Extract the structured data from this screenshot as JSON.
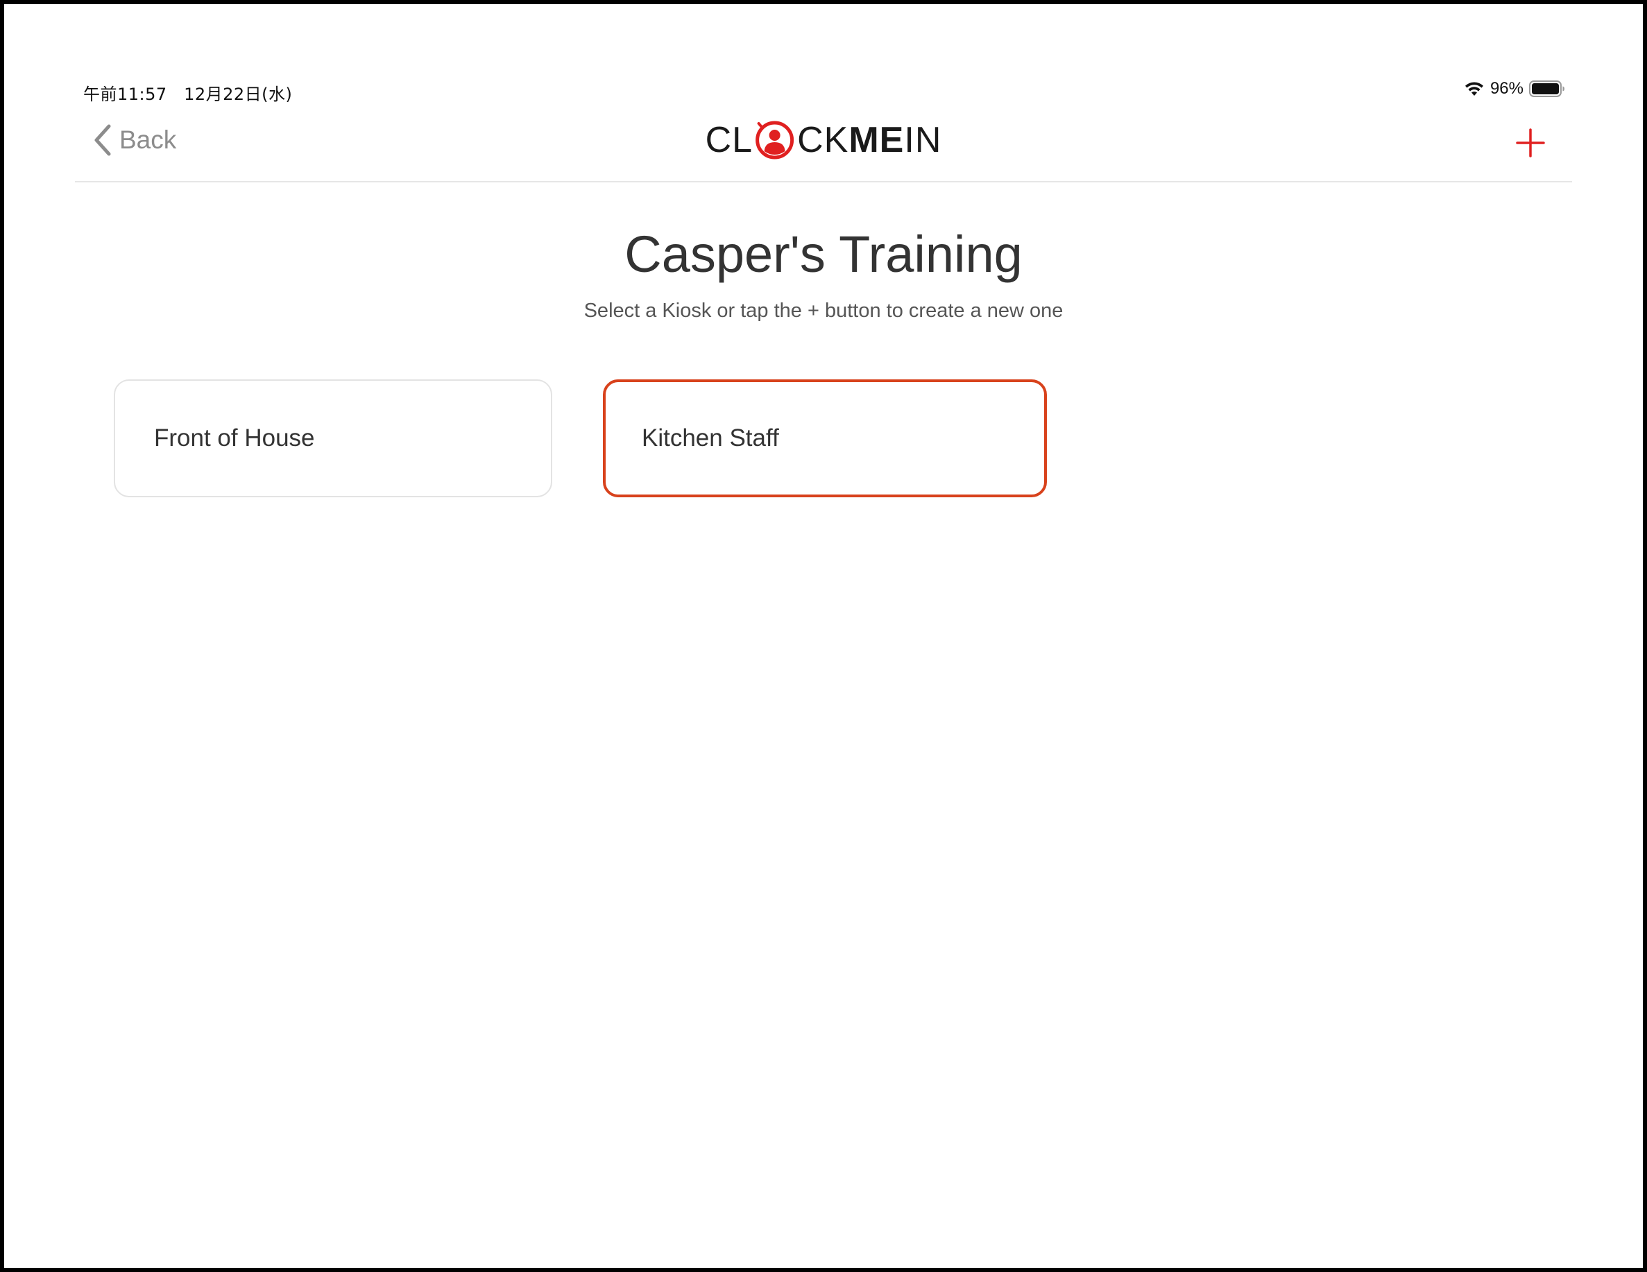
{
  "status_bar": {
    "time": "午前11:57",
    "date": "12月22日(水)",
    "battery": "96%",
    "icons": [
      "wifi-icon",
      "battery-icon"
    ]
  },
  "nav": {
    "back_label": "Back",
    "back_icon": "chevron-left-icon",
    "logo": {
      "part1": "CL",
      "part2": "CK",
      "part3": "ME",
      "part4": "IN",
      "mark_icon": "clock-person-icon"
    },
    "add_icon": "plus-icon"
  },
  "page": {
    "title": "Casper's Training",
    "subtitle": "Select a Kiosk or tap the + button to create a new one"
  },
  "kiosks": [
    {
      "label": "Front of House",
      "selected": false
    },
    {
      "label": "Kitchen Staff",
      "selected": true
    }
  ],
  "colors": {
    "accent": "#d8421c",
    "brand_red": "#e02020",
    "text_dark": "#333333",
    "text_muted": "#8c8c8c",
    "card_border": "#e3e3e3"
  }
}
